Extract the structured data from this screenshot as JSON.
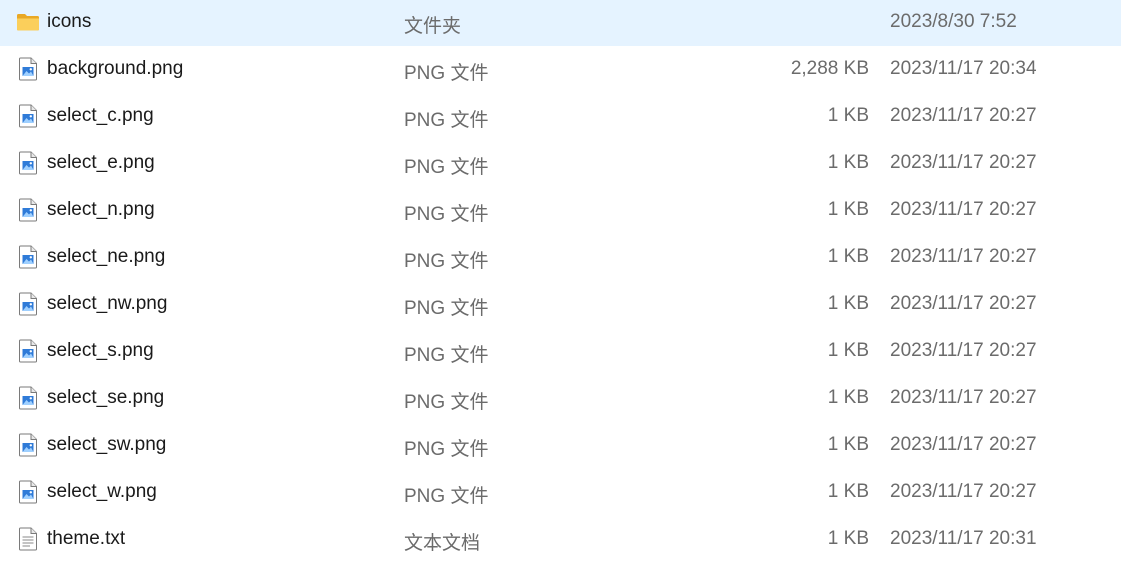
{
  "files": [
    {
      "name": "icons",
      "type": "文件夹",
      "size": "",
      "date": "2023/8/30 7:52",
      "icon": "folder-icon"
    },
    {
      "name": "background.png",
      "type": "PNG 文件",
      "size": "2,288 KB",
      "date": "2023/11/17 20:34",
      "icon": "image-file-icon"
    },
    {
      "name": "select_c.png",
      "type": "PNG 文件",
      "size": "1 KB",
      "date": "2023/11/17 20:27",
      "icon": "image-file-icon"
    },
    {
      "name": "select_e.png",
      "type": "PNG 文件",
      "size": "1 KB",
      "date": "2023/11/17 20:27",
      "icon": "image-file-icon"
    },
    {
      "name": "select_n.png",
      "type": "PNG 文件",
      "size": "1 KB",
      "date": "2023/11/17 20:27",
      "icon": "image-file-icon"
    },
    {
      "name": "select_ne.png",
      "type": "PNG 文件",
      "size": "1 KB",
      "date": "2023/11/17 20:27",
      "icon": "image-file-icon"
    },
    {
      "name": "select_nw.png",
      "type": "PNG 文件",
      "size": "1 KB",
      "date": "2023/11/17 20:27",
      "icon": "image-file-icon"
    },
    {
      "name": "select_s.png",
      "type": "PNG 文件",
      "size": "1 KB",
      "date": "2023/11/17 20:27",
      "icon": "image-file-icon"
    },
    {
      "name": "select_se.png",
      "type": "PNG 文件",
      "size": "1 KB",
      "date": "2023/11/17 20:27",
      "icon": "image-file-icon"
    },
    {
      "name": "select_sw.png",
      "type": "PNG 文件",
      "size": "1 KB",
      "date": "2023/11/17 20:27",
      "icon": "image-file-icon"
    },
    {
      "name": "select_w.png",
      "type": "PNG 文件",
      "size": "1 KB",
      "date": "2023/11/17 20:27",
      "icon": "image-file-icon"
    },
    {
      "name": "theme.txt",
      "type": "文本文档",
      "size": "1 KB",
      "date": "2023/11/17 20:31",
      "icon": "text-file-icon"
    }
  ],
  "colors": {
    "folder": "#f8c44f",
    "image_accent": "#2f7bd8",
    "text_primary": "#1a1a1a",
    "text_secondary": "#6b6b6b"
  }
}
